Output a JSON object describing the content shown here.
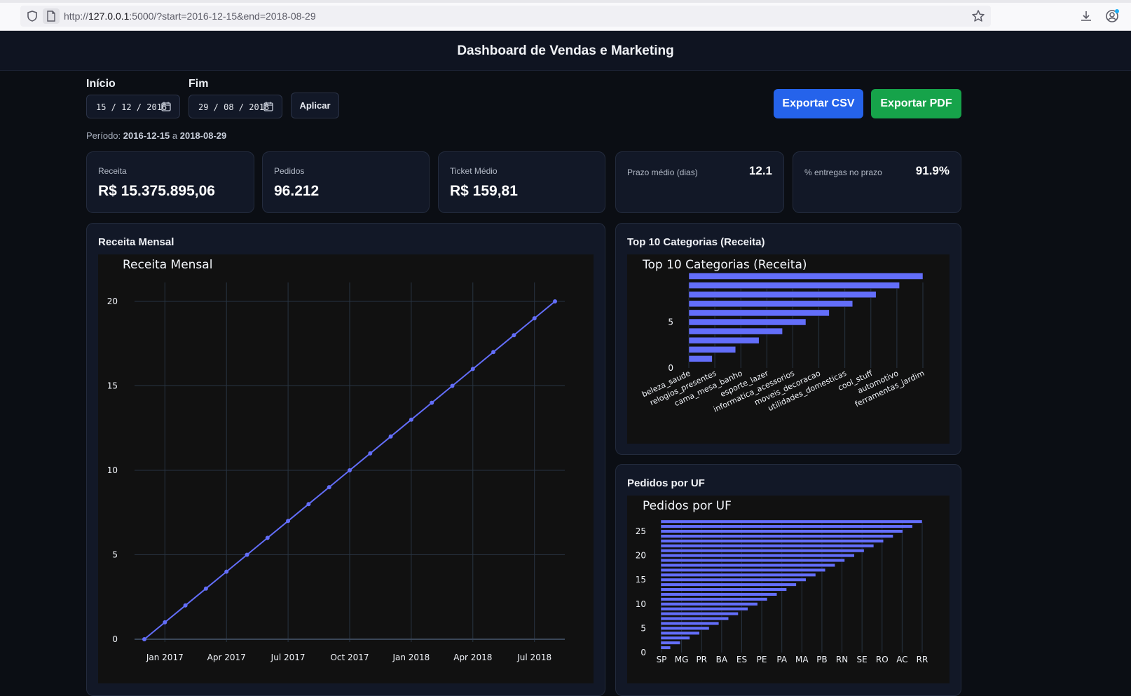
{
  "browser": {
    "url_prefix": "http://",
    "url_host": "127.0.0.1",
    "url_rest": ":5000/?start=2016-12-15&end=2018-08-29"
  },
  "header": {
    "title": "Dashboard de Vendas e Marketing"
  },
  "filters": {
    "start_label": "Início",
    "start_value": "15 / 12 / 2016",
    "end_label": "Fim",
    "end_value": "29 / 08 / 2018",
    "apply_label": "Aplicar",
    "export_csv_label": "Exportar CSV",
    "export_pdf_label": "Exportar PDF",
    "period_prefix": "Período:",
    "period_start": "2016-12-15",
    "period_sep": "a",
    "period_end": "2018-08-29"
  },
  "kpis": {
    "receita_label": "Receita",
    "receita_value": "R$ 15.375.895,06",
    "pedidos_label": "Pedidos",
    "pedidos_value": "96.212",
    "ticket_label": "Ticket Médio",
    "ticket_value": "R$ 159,81",
    "prazo_label": "Prazo médio (dias)",
    "prazo_value": "12.1",
    "entregas_label": "% entregas no prazo",
    "entregas_value": "91.9%"
  },
  "panels": {
    "receita_title": "Receita Mensal",
    "categorias_title": "Top 10 Categorias (Receita)",
    "uf_title": "Pedidos por UF"
  },
  "colors": {
    "series": "#636efa",
    "plot_bg": "#111111",
    "grid": "#283442",
    "csv": "#2563eb",
    "pdf": "#16a34a"
  },
  "chart_data": [
    {
      "type": "line",
      "title": "Receita Mensal",
      "x": [
        "2016-12",
        "2017-01",
        "2017-02",
        "2017-03",
        "2017-04",
        "2017-05",
        "2017-06",
        "2017-07",
        "2017-08",
        "2017-09",
        "2017-10",
        "2017-11",
        "2017-12",
        "2018-01",
        "2018-02",
        "2018-03",
        "2018-04",
        "2018-05",
        "2018-06",
        "2018-07",
        "2018-08"
      ],
      "values": [
        0,
        1,
        2,
        3,
        4,
        5,
        6,
        7,
        8,
        9,
        10,
        11,
        12,
        13,
        14,
        15,
        16,
        17,
        18,
        19,
        20
      ],
      "x_ticks": [
        "Jan 2017",
        "Apr 2017",
        "Jul 2017",
        "Oct 2017",
        "Jan 2018",
        "Apr 2018",
        "Jul 2018"
      ],
      "y_ticks": [
        0,
        5,
        10,
        15,
        20
      ],
      "ylim": [
        0,
        20
      ],
      "grid": true
    },
    {
      "type": "bar",
      "title": "Top 10 Categorias (Receita)",
      "categories": [
        "beleza_saude",
        "relogios_presentes",
        "cama_mesa_banho",
        "esporte_lazer",
        "informatica_acessorios",
        "moveis_decoracao",
        "utilidades_domesticas",
        "cool_stuff",
        "automotivo",
        "ferramentas_jardim"
      ],
      "values": [
        1,
        2,
        3,
        4,
        5,
        6,
        7,
        8,
        9,
        10
      ],
      "y_ticks": [
        0,
        5
      ],
      "grid": true
    },
    {
      "type": "bar",
      "title": "Pedidos por UF",
      "categories": [
        "SP",
        "MG",
        "PR",
        "BA",
        "ES",
        "PE",
        "PA",
        "MA",
        "PB",
        "RN",
        "SE",
        "RO",
        "AC",
        "RR"
      ],
      "values": [
        1,
        2,
        3,
        4,
        5,
        6,
        7,
        8,
        9,
        10,
        11,
        12,
        13,
        14,
        15,
        16,
        17,
        18,
        19,
        20,
        21,
        22,
        23,
        24,
        25,
        26,
        27
      ],
      "y_ticks": [
        0,
        5,
        10,
        15,
        20,
        25
      ],
      "grid": true
    }
  ]
}
